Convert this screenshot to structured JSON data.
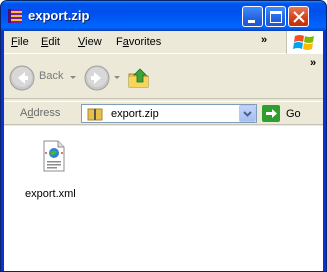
{
  "window": {
    "title": "export.zip"
  },
  "menubar": {
    "items": [
      {
        "label": "File",
        "accel": "F",
        "rest": "ile"
      },
      {
        "label": "Edit",
        "accel": "E",
        "rest": "dit"
      },
      {
        "label": "View",
        "accel": "V",
        "rest": "iew"
      },
      {
        "label": "Favorites",
        "pre": "F",
        "accel": "a",
        "rest": "vorites"
      }
    ],
    "overflow": "»"
  },
  "toolbar": {
    "back_label": "Back",
    "overflow": "»"
  },
  "addressbar": {
    "label_pre": "A",
    "label_accel": "d",
    "label_rest": "dress",
    "value": "export.zip",
    "go_label": "Go"
  },
  "content": {
    "files": [
      {
        "name": "export.xml",
        "icon": "xml-file-icon"
      }
    ]
  },
  "colors": {
    "titlebar": "#0058ee",
    "chrome": "#ece9d8",
    "close": "#d2401b",
    "go": "#2e9e2e"
  }
}
